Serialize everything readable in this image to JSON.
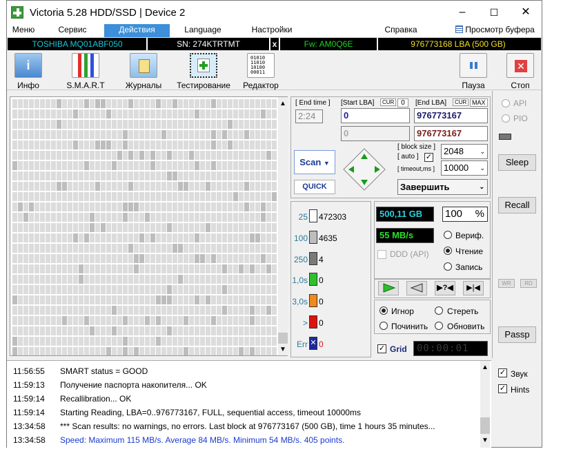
{
  "window": {
    "title": "Victoria 5.28 HDD/SSD | Device 2",
    "minimize": "–",
    "maximize": "☐",
    "close": "✕"
  },
  "menu": [
    "Меню",
    "Сервис",
    "Действия",
    "Language",
    "Настройки",
    "Справка",
    "Просмотр буфера"
  ],
  "infobar": {
    "model": "TOSHIBA MQ01ABF050",
    "serial": "SN: 274KTRTMT",
    "x": "x",
    "firmware": "Fw: AM0Q6E",
    "capacity": "976773168 LBA (500 GB)"
  },
  "toolbar": [
    "Инфо",
    "S.M.A.R.T",
    "Журналы",
    "Тестирование",
    "Редактор",
    "Пауза",
    "Стоп"
  ],
  "scan_params": {
    "end_time_label": "[ End time ]",
    "end_time": "2:24",
    "start_lba_label": "[Start LBA]",
    "cur1": "CUR",
    "zero": "0",
    "end_lba_label": "[End LBA]",
    "cur2": "CUR",
    "max": "MAX",
    "start_lba": "0",
    "end_lba": "976773167",
    "start_lba2": "0",
    "end_lba2": "976773167",
    "block_size_label": "[ block size ]",
    "auto_label": "[ auto ]",
    "block_size": "2048",
    "timeout_label": "[ timeout,ms ]",
    "timeout": "10000",
    "scan_button": "Scan",
    "quick_button": "QUICK",
    "finish_select": "Завершить"
  },
  "legend": [
    {
      "label": "25",
      "count": "472303",
      "color": "#ffffff"
    },
    {
      "label": "100",
      "count": "4635",
      "color": "#bdbdbd"
    },
    {
      "label": "250",
      "count": "4",
      "color": "#7a7a7a"
    },
    {
      "label": "1,0s",
      "count": "0",
      "color": "#2ec02e"
    },
    {
      "label": "3,0s",
      "count": "0",
      "color": "#f08a1a"
    },
    {
      "label": ">",
      "count": "0",
      "color": "#e01010"
    },
    {
      "label": "Err",
      "count": "0",
      "color": "#1a2a9a"
    }
  ],
  "stats": {
    "size": "500,11 GB",
    "percent": "100",
    "percent_unit": "%",
    "speed": "55 MB/s",
    "ddd_label": "DDD (API)"
  },
  "modes": [
    "Вериф.",
    "Чтение",
    "Запись"
  ],
  "actions": [
    "Игнор",
    "Стереть",
    "Починить",
    "Обновить"
  ],
  "grid_label": "Grid",
  "timer": "00:00:01",
  "right_panel": {
    "api": "API",
    "pio": "PIO",
    "sleep": "Sleep",
    "recall": "Recall",
    "wr": "WR",
    "rd": "RD",
    "passp": "Passp",
    "sound": "Звук",
    "hints": "Hints"
  },
  "log": [
    {
      "time": "11:56:55",
      "text": "SMART status = GOOD",
      "color": "#000000"
    },
    {
      "time": "11:59:13",
      "text": "Получение паспорта накопителя... OK",
      "color": "#000000"
    },
    {
      "time": "11:59:14",
      "text": "Recallibration... OK",
      "color": "#000000"
    },
    {
      "time": "11:59:14",
      "text": "Starting Reading, LBA=0..976773167, FULL, sequential access, timeout 10000ms",
      "color": "#000000"
    },
    {
      "time": "13:34:58",
      "text": "*** Scan results: no warnings, no errors. Last block at 976773167 (500 GB), time 1 hours 35 minutes...",
      "color": "#000000"
    },
    {
      "time": "13:34:58",
      "text": "Speed: Maximum 115 MB/s. Average 84 MB/s. Minimum 54 MB/s. 405 points.",
      "color": "#1a3ad0"
    }
  ]
}
